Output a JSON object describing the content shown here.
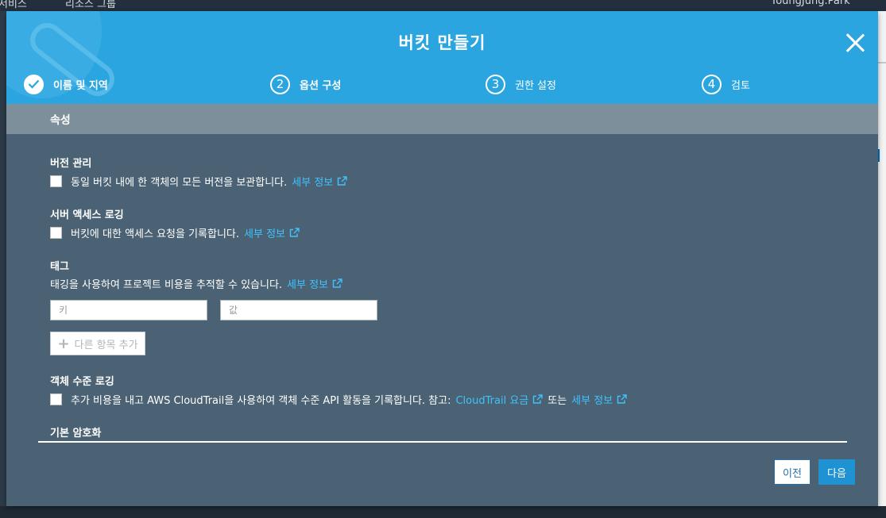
{
  "background": {
    "topbar_left_1": "서비스",
    "topbar_left_2": "리소스 그룹",
    "topbar_user": "YoungJung.Park"
  },
  "modal": {
    "title": "버킷 만들기",
    "steps": [
      {
        "number": "1",
        "label": "이름 및 지역",
        "state": "done"
      },
      {
        "number": "2",
        "label": "옵션 구성",
        "state": "active"
      },
      {
        "number": "3",
        "label": "권한 설정",
        "state": "pending"
      },
      {
        "number": "4",
        "label": "검토",
        "state": "pending"
      }
    ],
    "section_title": "속성",
    "versioning": {
      "title": "버전 관리",
      "checkbox_text": "동일 버킷 내에 한 객체의 모든 버전을 보관합니다.",
      "link": "세부 정보"
    },
    "logging": {
      "title": "서버 액세스 로깅",
      "checkbox_text": "버킷에 대한 액세스 요청을 기록합니다.",
      "link": "세부 정보"
    },
    "tags": {
      "title": "태그",
      "description": "태깅을 사용하여 프로젝트 비용을 추적할 수 있습니다.",
      "link": "세부 정보",
      "key_placeholder": "키",
      "value_placeholder": "값",
      "add_button": "다른 항목 추가"
    },
    "object_logging": {
      "title": "객체 수준 로깅",
      "checkbox_text": "추가 비용을 내고 AWS CloudTrail을 사용하여 객체 수준 API 활동을 기록합니다. 참고:",
      "link_pricing": "CloudTrail 요금",
      "or_text": "또는",
      "link_details": "세부 정보"
    },
    "encryption": {
      "title": "기본 암호화"
    },
    "buttons": {
      "previous": "이전",
      "next": "다음"
    }
  },
  "colors": {
    "header": "#2ba5e0",
    "body": "#4a6273",
    "section_bar": "#7d8f9b",
    "link": "#3fc2ff",
    "primary_button": "#1f92d4"
  }
}
